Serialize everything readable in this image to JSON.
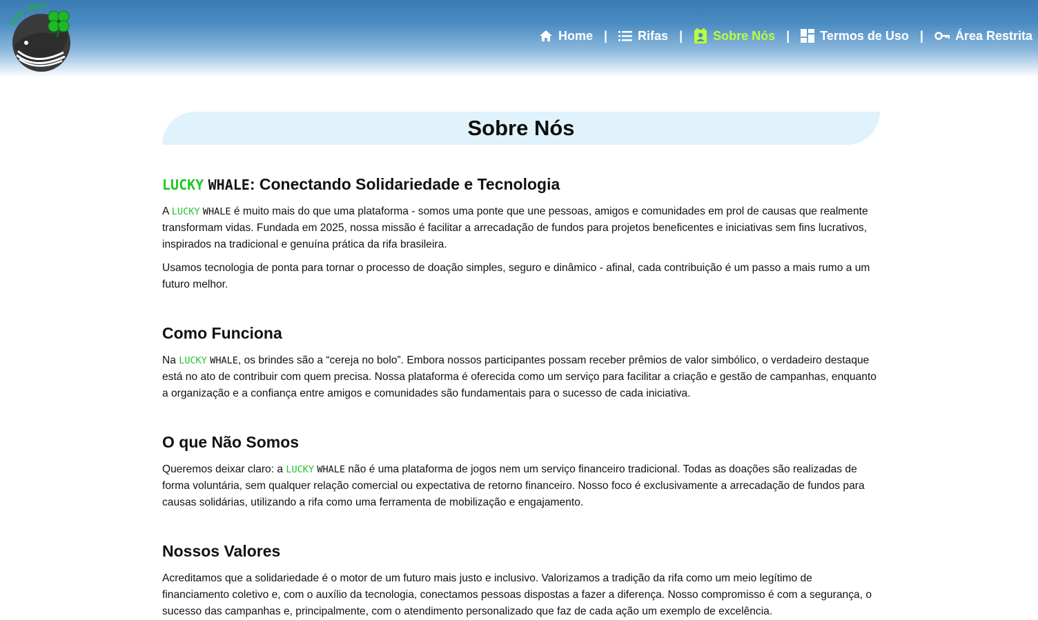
{
  "nav": {
    "items": [
      {
        "label": "Home",
        "icon": "home-icon",
        "active": false
      },
      {
        "label": "Rifas",
        "icon": "list-icon",
        "active": false
      },
      {
        "label": "Sobre Nós",
        "icon": "contact-card-icon",
        "active": true
      },
      {
        "label": "Termos de Uso",
        "icon": "dashboard-icon",
        "active": false
      },
      {
        "label": "Área Restrita",
        "icon": "key-icon",
        "active": false
      }
    ],
    "separator": "|"
  },
  "logo": {
    "text": "LUCKY WHALE"
  },
  "page": {
    "title": "Sobre Nós"
  },
  "brand": {
    "lucky": "LUCKY",
    "whale": "WHALE"
  },
  "sections": {
    "intro": {
      "heading_suffix": ": Conectando Solidariedade e Tecnologia",
      "p1_pre": "A ",
      "p1_post": " é muito mais do que uma plataforma - somos uma ponte que une pessoas, amigos e comunidades em prol de causas que realmente transformam vidas. Fundada em 2025, nossa missão é facilitar a arrecadação de fundos para projetos beneficentes e iniciativas sem fins lucrativos, inspirados na tradicional e genuína prática da rifa brasileira.",
      "p2": "Usamos tecnologia de ponta para tornar o processo de doação simples, seguro e dinâmico - afinal, cada contribuição é um passo a mais rumo a um futuro melhor."
    },
    "how": {
      "heading": "Como Funciona",
      "p_pre": "Na ",
      "p_post": ", os brindes são a “cereja no bolo”. Embora nossos participantes possam receber prêmios de valor simbólico, o verdadeiro destaque está no ato de contribuir com quem precisa. Nossa plataforma é oferecida como um serviço para facilitar a criação e gestão de campanhas, enquanto a organização e a confiança entre amigos e comunidades são fundamentais para o sucesso de cada iniciativa."
    },
    "not": {
      "heading": "O que Não Somos",
      "p_pre": "Queremos deixar claro: a ",
      "p_post": " não é uma plataforma de jogos nem um serviço financeiro tradicional. Todas as doações são realizadas de forma voluntária, sem qualquer relação comercial ou expectativa de retorno financeiro. Nosso foco é exclusivamente a arrecadação de fundos para causas solidárias, utilizando a rifa como uma ferramenta de mobilização e engajamento."
    },
    "values": {
      "heading": "Nossos Valores",
      "p": "Acreditamos que a solidariedade é o motor de um futuro mais justo e inclusivo. Valorizamos a tradição da rifa como um meio legítimo de financiamento coletivo e, com o auxílio da tecnologia, conectamos pessoas dispostas a fazer a diferença. Nosso compromisso é com a segurança, o sucesso das campanhas e, principalmente, com o atendimento personalizado que faz de cada ação um exemplo de excelência."
    }
  },
  "colors": {
    "accent_green": "#22c42a",
    "nav_active": "#b8ff3c",
    "header_blue": "#3a7bb3",
    "banner_bg": "#e0f2fb"
  }
}
